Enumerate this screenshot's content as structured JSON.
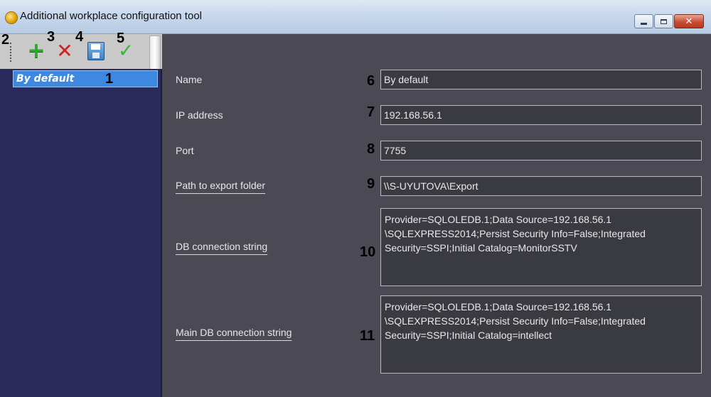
{
  "window": {
    "title": "Additional workplace configuration tool",
    "minimize_glyph": "",
    "maximize_glyph": "",
    "close_glyph": "✕"
  },
  "toolbar": {
    "icons": [
      "add-icon",
      "delete-icon",
      "save-icon",
      "apply-icon"
    ]
  },
  "callouts": [
    "1",
    "2",
    "3",
    "4",
    "5",
    "6",
    "7",
    "8",
    "9",
    "10",
    "11"
  ],
  "sidebar": {
    "items": [
      {
        "label": "By default",
        "selected": true
      }
    ]
  },
  "form": {
    "name": {
      "label": "Name",
      "value": "By default"
    },
    "ip": {
      "label": "IP address",
      "value": "192.168.56.1"
    },
    "port": {
      "label": "Port",
      "value": "7755"
    },
    "export": {
      "label": "Path to export folder",
      "value": "\\\\S-UYUTOVA\\Export"
    },
    "db": {
      "label": "DB connection string",
      "value": "Provider=SQLOLEDB.1;Data Source=192.168.56.1 \\SQLEXPRESS2014;Persist Security Info=False;Integrated Security=SSPI;Initial Catalog=MonitorSSTV"
    },
    "main_db": {
      "label": "Main DB connection string",
      "value": "Provider=SQLOLEDB.1;Data Source=192.168.56.1 \\SQLEXPRESS2014;Persist Security Info=False;Integrated Security=SSPI;Initial Catalog=intellect"
    }
  },
  "colors": {
    "sidebar_bg": "#2b2a5c",
    "selection": "#3d88e0",
    "main_bg": "#4b4a54",
    "field_bg": "#3a3a41"
  }
}
